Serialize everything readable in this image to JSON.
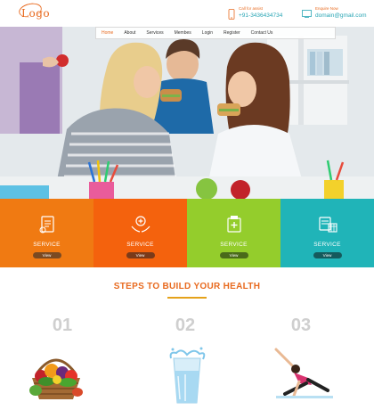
{
  "header": {
    "logo_text": "Logo",
    "phone": {
      "label": "Call for assist",
      "value": "+91-3436434734",
      "icon": "phone-icon"
    },
    "email": {
      "label": "Enquire Now",
      "value": "domain@gmail.com",
      "icon": "mail-icon"
    }
  },
  "nav": {
    "items": [
      "Home",
      "About",
      "Services",
      "Membes",
      "Login",
      "Register",
      "Contact Us"
    ],
    "active": "Home"
  },
  "colors": {
    "accent": "#e86a1f",
    "teal": "#2aa6b5",
    "tile_1": "#f07a12",
    "tile_2": "#f4620d",
    "tile_3": "#94cd2c",
    "tile_4": "#20b4b8"
  },
  "services": [
    {
      "label": "SERVICE",
      "button": "View",
      "icon": "document-list-icon"
    },
    {
      "label": "SERVICE",
      "button": "View",
      "icon": "hands-care-icon"
    },
    {
      "label": "SERVICE",
      "button": "View",
      "icon": "medicine-chart-icon"
    },
    {
      "label": "SERVICE",
      "button": "View",
      "icon": "calendar-report-icon"
    }
  ],
  "steps": {
    "title": "STEPS TO BUILD YOUR HEALTH",
    "items": [
      {
        "number": "01",
        "image": "vegetable-basket-image"
      },
      {
        "number": "02",
        "image": "water-glass-image"
      },
      {
        "number": "03",
        "image": "yoga-pose-image"
      }
    ]
  }
}
